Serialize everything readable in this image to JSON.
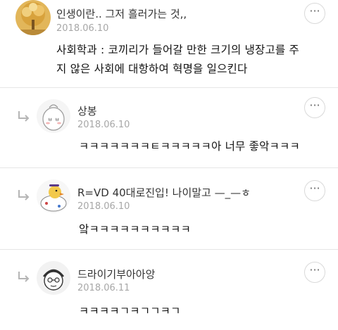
{
  "comments": [
    {
      "author": "인생이란.. 그저 흘러가는 것,,",
      "date": "2018.06.10",
      "body_line1": "사회학과 : 코끼리가 들어갈 만한 크기의 냉장고를 주",
      "body_line2": "지 않은 사회에 대항하여 혁명을 일으킨다",
      "more_label": "···"
    },
    {
      "author": "상봉",
      "date": "2018.06.10",
      "body": "ㅋㅋㅋㅋㅋㅋㅋㅌㅋㅋㅋㅋㅋ아 너무 좋악ㅋㅋㅋ",
      "more_label": "···"
    },
    {
      "author": "R=VD 40대로진입! 나이말고 —_—ㅎ",
      "date": "2018.06.10",
      "body": "앜ㅋㅋㅋㅋㅋㅋㅋㅋㅋㅋ",
      "more_label": "···"
    },
    {
      "author": "드라이기부아아앙",
      "date": "2018.06.11",
      "body": "ㅋㅋㅋㅋㄱㅋㄱㄱㅋㄱ",
      "more_label": "···"
    }
  ],
  "colors": {
    "date": "#a7a7a7",
    "divider": "#e6e6e6",
    "reply_arrow": "#b5b5b5"
  },
  "icons": [
    "reply-arrow-icon",
    "more-options-icon",
    "avatar-tree",
    "avatar-egg",
    "avatar-duck",
    "avatar-sketch"
  ]
}
